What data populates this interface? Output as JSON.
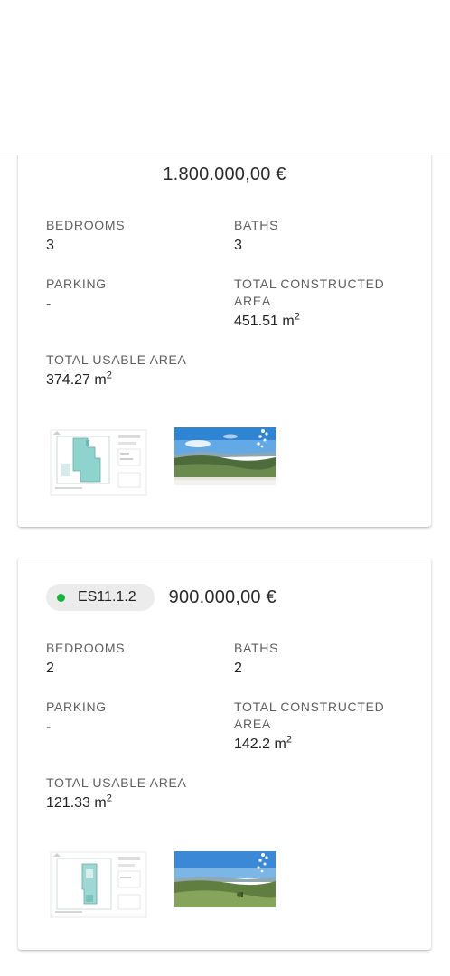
{
  "listings": [
    {
      "price": "1.800.000,00 €",
      "bedrooms": {
        "label": "BEDROOMS",
        "value": "3"
      },
      "baths": {
        "label": "BATHS",
        "value": "3"
      },
      "parking": {
        "label": "PARKING",
        "value": "-"
      },
      "constructed": {
        "label": "TOTAL CONSTRUCTED AREA",
        "value": "451.51 m",
        "unit_exp": "2"
      },
      "usable": {
        "label": "TOTAL USABLE AREA",
        "value": "374.27 m",
        "unit_exp": "2"
      }
    },
    {
      "chip": {
        "label": "ES11.1.2",
        "status_color": "#18b33a"
      },
      "price": "900.000,00 €",
      "bedrooms": {
        "label": "BEDROOMS",
        "value": "2"
      },
      "baths": {
        "label": "BATHS",
        "value": "2"
      },
      "parking": {
        "label": "PARKING",
        "value": "-"
      },
      "constructed": {
        "label": "TOTAL CONSTRUCTED AREA",
        "value": "142.2 m",
        "unit_exp": "2"
      },
      "usable": {
        "label": "TOTAL USABLE AREA",
        "value": "121.33 m",
        "unit_exp": "2"
      }
    }
  ],
  "icons": {
    "status": "status-dot-icon"
  }
}
